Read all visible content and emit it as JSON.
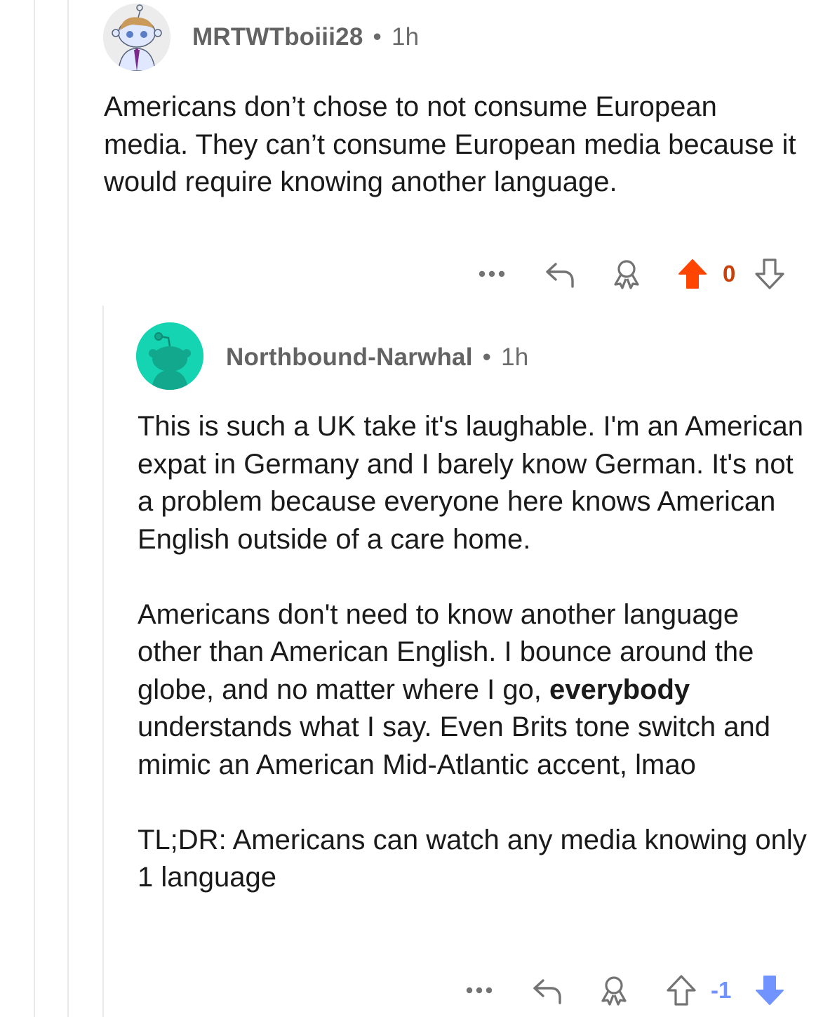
{
  "colors": {
    "upvote_active": "#ff4500",
    "downvote_active": "#7193ff",
    "icon_gray": "#737373",
    "avatar2_bg": "#14d4b2"
  },
  "comments": [
    {
      "username": "MRTWTboiii28",
      "separator": "•",
      "time": "1h",
      "avatar_icon": "snoo-avatar-icon",
      "paragraphs": [
        "Americans don’t chose to not consume European media. They can’t consume European media because it would require knowing another language."
      ],
      "score": "0",
      "vote_state": "upvoted"
    },
    {
      "username": "Northbound-Narwhal",
      "separator": "•",
      "time": "1h",
      "avatar_icon": "snoo-default-avatar-icon",
      "paragraphs": [
        "This is such a UK take it's laughable. I'm an American expat in Germany and I barely know German. It's not a problem because everyone here knows American English outside of a care home.",
        {
          "before": "Americans don't need to know another language other than American English. I bounce around the globe, and no matter where I go, ",
          "bold": "everybody",
          "after": " understands what I say. Even Brits tone switch and mimic an American Mid-Atlantic accent, lmao"
        },
        "TL;DR: Americans can watch any media knowing only 1 language"
      ],
      "score": "-1",
      "vote_state": "downvoted"
    }
  ]
}
